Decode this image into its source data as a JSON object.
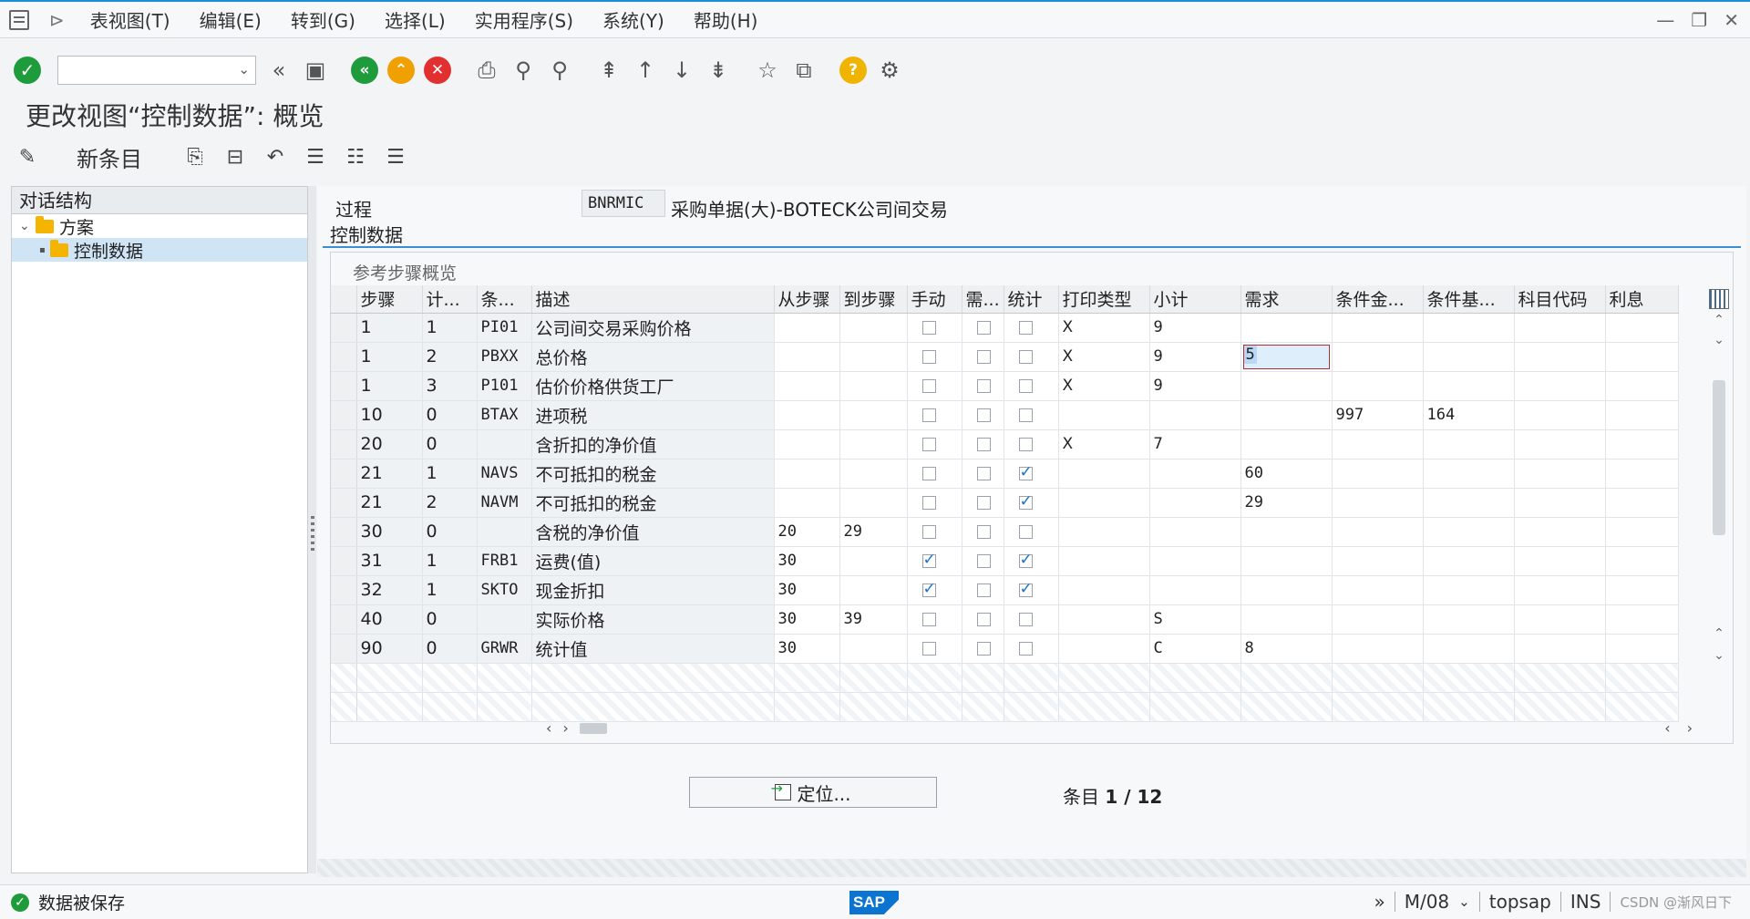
{
  "menu": {
    "items": [
      "表视图(T)",
      "编辑(E)",
      "转到(G)",
      "选择(L)",
      "实用程序(S)",
      "系统(Y)",
      "帮助(H)"
    ]
  },
  "window_controls": [
    "—",
    "❐",
    "✕"
  ],
  "page_title": "更改视图“控制数据”: 概览",
  "app_toolbar": {
    "new_entry": "新条目"
  },
  "tree": {
    "header": "对话结构",
    "items": [
      {
        "label": "方案",
        "level": 0,
        "expanded": true
      },
      {
        "label": "控制数据",
        "level": 1,
        "selected": true
      }
    ]
  },
  "process": {
    "label": "过程",
    "code": "BNRMIC",
    "description": "采购单据(大)-BOTECK公司间交易"
  },
  "section_title": "控制数据",
  "grid": {
    "title": "参考步骤概览",
    "columns": [
      "步骤",
      "计...",
      "条...",
      "描述",
      "从步骤",
      "到步骤",
      "手动",
      "需...",
      "统计",
      "打印类型",
      "小计",
      "需求",
      "条件金...",
      "条件基...",
      "科目代码",
      "利息"
    ],
    "rows": [
      [
        "1",
        "1",
        "PI01",
        "公司间交易采购价格",
        "",
        "",
        false,
        false,
        false,
        "X",
        "9",
        "",
        "",
        "",
        "",
        ""
      ],
      [
        "1",
        "2",
        "PBXX",
        "总价格",
        "",
        "",
        false,
        false,
        false,
        "X",
        "9",
        "5",
        "",
        "",
        "",
        ""
      ],
      [
        "1",
        "3",
        "P101",
        "估价价格供货工厂",
        "",
        "",
        false,
        false,
        false,
        "X",
        "9",
        "",
        "",
        "",
        "",
        ""
      ],
      [
        "10",
        "0",
        "BTAX",
        "进项税",
        "",
        "",
        false,
        false,
        false,
        "",
        "",
        "",
        "997",
        "164",
        "",
        ""
      ],
      [
        "20",
        "0",
        "",
        "含折扣的净价值",
        "",
        "",
        false,
        false,
        false,
        "X",
        "7",
        "",
        "",
        "",
        "",
        ""
      ],
      [
        "21",
        "1",
        "NAVS",
        "不可抵扣的税金",
        "",
        "",
        false,
        false,
        true,
        "",
        "",
        "60",
        "",
        "",
        "",
        ""
      ],
      [
        "21",
        "2",
        "NAVM",
        "不可抵扣的税金",
        "",
        "",
        false,
        false,
        true,
        "",
        "",
        "29",
        "",
        "",
        "",
        ""
      ],
      [
        "30",
        "0",
        "",
        "含税的净价值",
        "20",
        "29",
        false,
        false,
        false,
        "",
        "",
        "",
        "",
        "",
        "",
        ""
      ],
      [
        "31",
        "1",
        "FRB1",
        "运费(值)",
        "30",
        "",
        true,
        false,
        true,
        "",
        "",
        "",
        "",
        "",
        "",
        ""
      ],
      [
        "32",
        "1",
        "SKTO",
        "现金折扣",
        "30",
        "",
        true,
        false,
        true,
        "",
        "",
        "",
        "",
        "",
        "",
        ""
      ],
      [
        "40",
        "0",
        "",
        "实际价格",
        "30",
        "39",
        false,
        false,
        false,
        "",
        "S",
        "",
        "",
        "",
        "",
        ""
      ],
      [
        "90",
        "0",
        "GRWR",
        "统计值",
        "30",
        "",
        false,
        false,
        false,
        "",
        "C",
        "8",
        "",
        "",
        "",
        ""
      ]
    ]
  },
  "position_button": "定位...",
  "entry_count": {
    "label": "条目",
    "value": "1 / 12"
  },
  "status": {
    "message": "数据被保存",
    "session": "M/08",
    "server": "topsap",
    "mode": "INS",
    "watermark": "CSDN @渐风日下"
  },
  "colors": {
    "accent": "#1a8fd6",
    "ok_green": "#1e9b3a",
    "sap_blue": "#0a74d0"
  }
}
